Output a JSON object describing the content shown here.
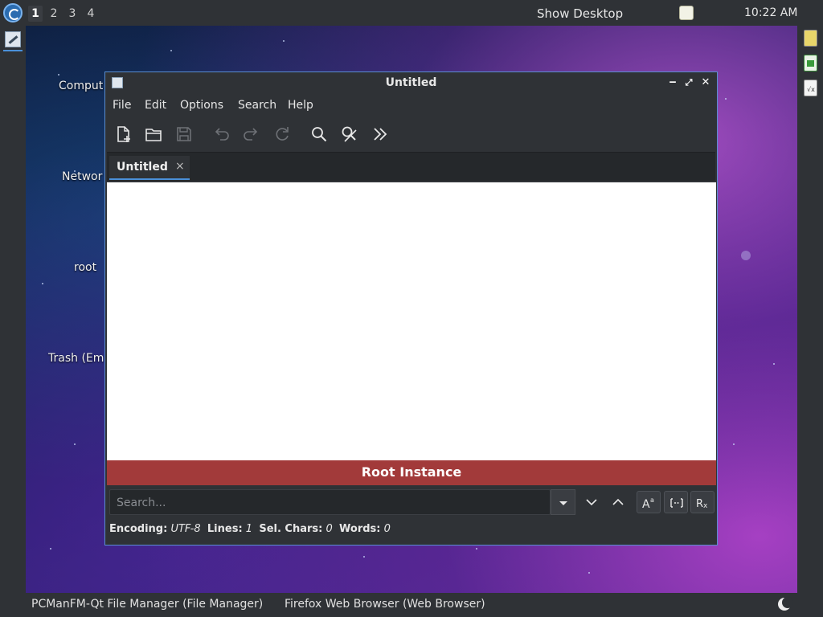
{
  "panel": {
    "workspaces": [
      "1",
      "2",
      "3",
      "4"
    ],
    "active_workspace": "1",
    "show_desktop": "Show Desktop",
    "clock": "10:22 AM"
  },
  "desktop": {
    "icons": [
      {
        "label": "Comput"
      },
      {
        "label": "Networ"
      },
      {
        "label": "root"
      },
      {
        "label": "Trash (Em"
      }
    ]
  },
  "window": {
    "title": "Untitled",
    "menu": [
      "File",
      "Edit",
      "Options",
      "Search",
      "Help"
    ],
    "toolbar_icons": [
      "new-document-icon",
      "open-folder-icon",
      "save-icon",
      "undo-icon",
      "redo-icon",
      "reload-icon",
      "find-icon",
      "find-replace-icon",
      "more-icon"
    ],
    "tab": {
      "label": "Untitled",
      "close": "×"
    },
    "root_banner": "Root Instance",
    "search": {
      "placeholder": "Search..."
    },
    "status": {
      "encoding_label": "Encoding:",
      "encoding_value": "UTF-8",
      "lines_label": "Lines:",
      "lines_value": "1",
      "sel_label": "Sel. Chars:",
      "sel_value": "0",
      "words_label": "Words:",
      "words_value": "0"
    }
  },
  "taskbar": {
    "tasks": [
      "PCManFM-Qt File Manager (File Manager)",
      "Firefox Web Browser (Web Browser)"
    ]
  },
  "colors": {
    "panel_bg": "#2f3236",
    "accent": "#4a90d9",
    "root_banner_bg": "#a23a3a",
    "window_border": "#5b8fd1"
  }
}
